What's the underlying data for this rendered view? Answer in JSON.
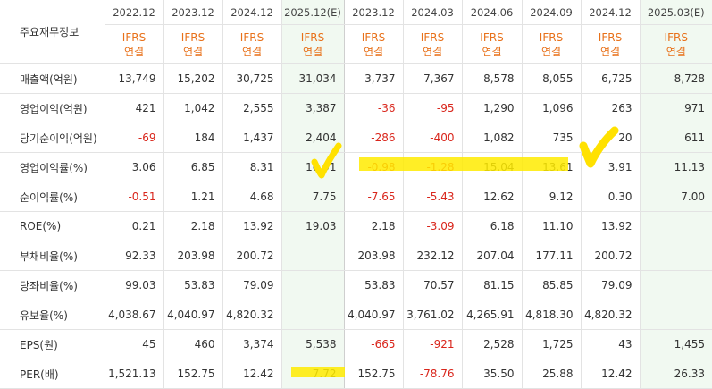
{
  "corner_label": "주요재무정보",
  "periods": [
    "2022.12",
    "2023.12",
    "2024.12",
    "2025.12(E)",
    "2023.12",
    "2024.03",
    "2024.06",
    "2024.09",
    "2024.12",
    "2025.03(E)"
  ],
  "ifrs_line1": "IFRS",
  "ifrs_line2": "연결",
  "rows": [
    {
      "label": "매출액(억원)",
      "values": [
        "13,749",
        "15,202",
        "30,725",
        "31,034",
        "3,737",
        "7,367",
        "8,578",
        "8,055",
        "6,725",
        "8,728"
      ],
      "negative": [
        false,
        false,
        false,
        false,
        false,
        false,
        false,
        false,
        false,
        false
      ]
    },
    {
      "label": "영업이익(억원)",
      "values": [
        "421",
        "1,042",
        "2,555",
        "3,387",
        "-36",
        "-95",
        "1,290",
        "1,096",
        "263",
        "971"
      ],
      "negative": [
        false,
        false,
        false,
        false,
        true,
        true,
        false,
        false,
        false,
        false
      ]
    },
    {
      "label": "당기순이익(억원)",
      "values": [
        "-69",
        "184",
        "1,437",
        "2,404",
        "-286",
        "-400",
        "1,082",
        "735",
        "20",
        "611"
      ],
      "negative": [
        true,
        false,
        false,
        false,
        true,
        true,
        false,
        false,
        false,
        false
      ]
    },
    {
      "label": "영업이익률(%)",
      "values": [
        "3.06",
        "6.85",
        "8.31",
        "10.91",
        "-0.98",
        "-1.28",
        "15.04",
        "13.61",
        "3.91",
        "11.13"
      ],
      "negative": [
        false,
        false,
        false,
        false,
        true,
        true,
        false,
        false,
        false,
        false
      ]
    },
    {
      "label": "순이익률(%)",
      "values": [
        "-0.51",
        "1.21",
        "4.68",
        "7.75",
        "-7.65",
        "-5.43",
        "12.62",
        "9.12",
        "0.30",
        "7.00"
      ],
      "negative": [
        true,
        false,
        false,
        false,
        true,
        true,
        false,
        false,
        false,
        false
      ]
    },
    {
      "label": "ROE(%)",
      "values": [
        "0.21",
        "2.18",
        "13.92",
        "19.03",
        "2.18",
        "-3.09",
        "6.18",
        "11.10",
        "13.92",
        ""
      ],
      "negative": [
        false,
        false,
        false,
        false,
        false,
        true,
        false,
        false,
        false,
        false
      ]
    },
    {
      "label": "부채비율(%)",
      "values": [
        "92.33",
        "203.98",
        "200.72",
        "",
        "203.98",
        "232.12",
        "207.04",
        "177.11",
        "200.72",
        ""
      ],
      "negative": [
        false,
        false,
        false,
        false,
        false,
        false,
        false,
        false,
        false,
        false
      ]
    },
    {
      "label": "당좌비율(%)",
      "values": [
        "99.03",
        "53.83",
        "79.09",
        "",
        "53.83",
        "70.57",
        "81.15",
        "85.85",
        "79.09",
        ""
      ],
      "negative": [
        false,
        false,
        false,
        false,
        false,
        false,
        false,
        false,
        false,
        false
      ]
    },
    {
      "label": "유보율(%)",
      "values": [
        "4,038.67",
        "4,040.97",
        "4,820.32",
        "",
        "4,040.97",
        "3,761.02",
        "4,265.91",
        "4,818.30",
        "4,820.32",
        ""
      ],
      "negative": [
        false,
        false,
        false,
        false,
        false,
        false,
        false,
        false,
        false,
        false
      ]
    },
    {
      "label": "EPS(원)",
      "values": [
        "45",
        "460",
        "3,374",
        "5,538",
        "-665",
        "-921",
        "2,528",
        "1,725",
        "43",
        "1,455"
      ],
      "negative": [
        false,
        false,
        false,
        false,
        true,
        true,
        false,
        false,
        false,
        false
      ]
    },
    {
      "label": "PER(배)",
      "values": [
        "1,521.13",
        "152.75",
        "12.42",
        "7.72",
        "152.75",
        "-78.76",
        "35.50",
        "25.88",
        "12.42",
        "26.33"
      ],
      "negative": [
        false,
        false,
        false,
        false,
        false,
        true,
        false,
        false,
        false,
        false
      ]
    }
  ],
  "colors": {
    "negative": "#d9261c",
    "ifrs": "#e8711a",
    "estimate_bg": "#f1f9f1",
    "highlight": "#ffeb00"
  }
}
